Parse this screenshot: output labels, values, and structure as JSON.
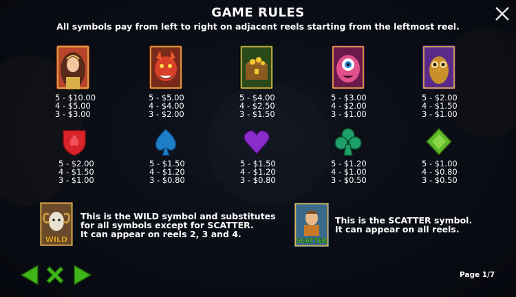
{
  "header": {
    "title": "GAME RULES",
    "subtitle": "All symbols pay from left to right on adjacent reels starting from the leftmost reel."
  },
  "high_symbols": [
    {
      "icon": "princess-icon",
      "pays": [
        "5 - $10.00",
        "4 - $5.00",
        "3 - $3.00"
      ]
    },
    {
      "icon": "red-dragon-icon",
      "pays": [
        "5 - $5.00",
        "4 - $4.00",
        "3 - $2.00"
      ]
    },
    {
      "icon": "treasure-chest-icon",
      "pays": [
        "5 - $4.00",
        "4 - $2.50",
        "3 - $1.50"
      ]
    },
    {
      "icon": "one-eyed-monster-icon",
      "pays": [
        "5 - $3.00",
        "4 - $2.00",
        "3 - $1.00"
      ]
    },
    {
      "icon": "golden-owl-icon",
      "pays": [
        "5 - $2.00",
        "4 - $1.50",
        "3 - $1.00"
      ]
    }
  ],
  "low_symbols": [
    {
      "icon": "red-spade-shield-icon",
      "color": "#d8232a",
      "pays": [
        "5 - $2.00",
        "4 - $1.50",
        "3 - $1.00"
      ]
    },
    {
      "icon": "blue-spade-icon",
      "color": "#1e7fc9",
      "pays": [
        "5 - $1.50",
        "4 - $1.20",
        "3 - $0.80"
      ]
    },
    {
      "icon": "purple-heart-icon",
      "color": "#8b2bc9",
      "pays": [
        "5 - $1.50",
        "4 - $1.20",
        "3 - $0.80"
      ]
    },
    {
      "icon": "green-club-icon",
      "color": "#1ea06a",
      "pays": [
        "5 - $1.20",
        "4 - $1.00",
        "3 - $0.50"
      ]
    },
    {
      "icon": "green-diamond-icon",
      "color": "#5fb82a",
      "pays": [
        "5 - $1.00",
        "4 - $0.80",
        "3 - $0.50"
      ]
    }
  ],
  "specials": {
    "wild": {
      "icon": "wild-ram-icon",
      "badge": "WILD",
      "lines": [
        "This is the WILD symbol and substitutes",
        "for all symbols except for SCATTER.",
        "It can appear on reels 2, 3 and 4."
      ]
    },
    "scatter": {
      "icon": "scatter-hero-icon",
      "badge": "SCATTER",
      "lines": [
        "This is the SCATTER symbol.",
        "It can appear on all reels."
      ]
    }
  },
  "nav": {
    "prev_icon": "arrow-left-icon",
    "close_icon": "x-close-icon",
    "next_icon": "arrow-right-icon",
    "page_label": "Page 1/7",
    "accent": "#3fb51a"
  },
  "close_icon": "close-icon"
}
